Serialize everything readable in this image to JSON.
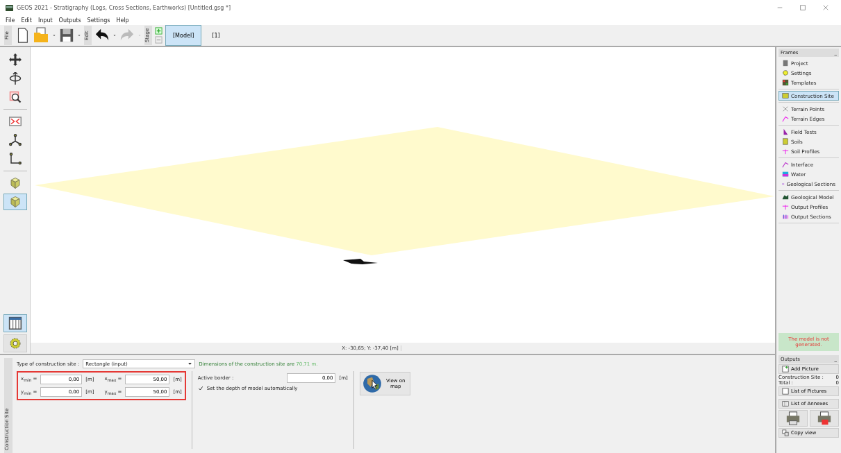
{
  "window": {
    "title": "GEOS 2021 - Stratigraphy (Logs, Cross Sections, Earthworks) [Untitled.gsg *]"
  },
  "menu": [
    "File",
    "Edit",
    "Input",
    "Outputs",
    "Settings",
    "Help"
  ],
  "toolbar": {
    "groups": [
      "File",
      "Edit",
      "Stage"
    ],
    "stages": [
      {
        "label": "[Model]",
        "selected": true
      },
      {
        "label": "[1]",
        "selected": false
      }
    ]
  },
  "tools": [
    {
      "selected": false
    },
    {
      "selected": false
    },
    {
      "selected": false
    },
    {
      "selected": false
    },
    {
      "selected": false
    },
    {
      "selected": false
    },
    {
      "selected": false
    },
    {
      "selected": true
    }
  ],
  "bottom_tools": [
    {
      "selected": true
    },
    {
      "selected": false
    }
  ],
  "status": "X: -30,65; Y: -37,40 [m]",
  "frames": {
    "title": "Frames",
    "collapse": "_",
    "groups": [
      [
        {
          "label": "Project",
          "selected": false
        },
        {
          "label": "Settings",
          "selected": false
        },
        {
          "label": "Templates",
          "selected": false
        }
      ],
      [
        {
          "label": "Construction Site",
          "selected": true
        }
      ],
      [
        {
          "label": "Terrain Points",
          "selected": false
        },
        {
          "label": "Terrain Edges",
          "selected": false
        }
      ],
      [
        {
          "label": "Field Tests",
          "selected": false
        },
        {
          "label": "Soils",
          "selected": false
        },
        {
          "label": "Soil Profiles",
          "selected": false
        }
      ],
      [
        {
          "label": "Interface",
          "selected": false
        },
        {
          "label": "Water",
          "selected": false
        },
        {
          "label": "Geological Sections",
          "selected": false
        }
      ],
      [
        {
          "label": "Geological Model",
          "selected": false
        },
        {
          "label": "Output Profiles",
          "selected": false
        },
        {
          "label": "Output Sections",
          "selected": false
        }
      ]
    ],
    "message": "The model is not generated."
  },
  "panel": {
    "tab": "Construction Site",
    "type_label": "Type of construction site :",
    "type_value": "Rectangle (input)",
    "dimensions": {
      "text": "Dimensions of the construction site are",
      "value": "70,71 m."
    },
    "fields": [
      {
        "label": "x$_{min}$ =",
        "value": "0,00",
        "unit": "[m]"
      },
      {
        "label": "x$_{max}$ =",
        "value": "50,00",
        "unit": "[m]"
      },
      {
        "label": "y$_{min}$ =",
        "value": "0,00",
        "unit": "[m]"
      },
      {
        "label": "y$_{max}$ =",
        "value": "50,00",
        "unit": "[m]"
      }
    ],
    "active_border": {
      "label": "Active border :",
      "value": "0,00",
      "unit": "[m]"
    },
    "auto_depth": {
      "label": "Set the depth of model automatically",
      "checked": true
    },
    "map_button": "View on map"
  },
  "outputs": {
    "title": "Outputs",
    "collapse": "_",
    "add_picture": "Add Picture",
    "counts": [
      {
        "label": "Construction Site :",
        "value": "0"
      },
      {
        "label": "Total :",
        "value": "0"
      }
    ],
    "list_pictures": "List of Pictures",
    "list_annexes": "List of Annexes",
    "copy_view": "Copy view"
  }
}
